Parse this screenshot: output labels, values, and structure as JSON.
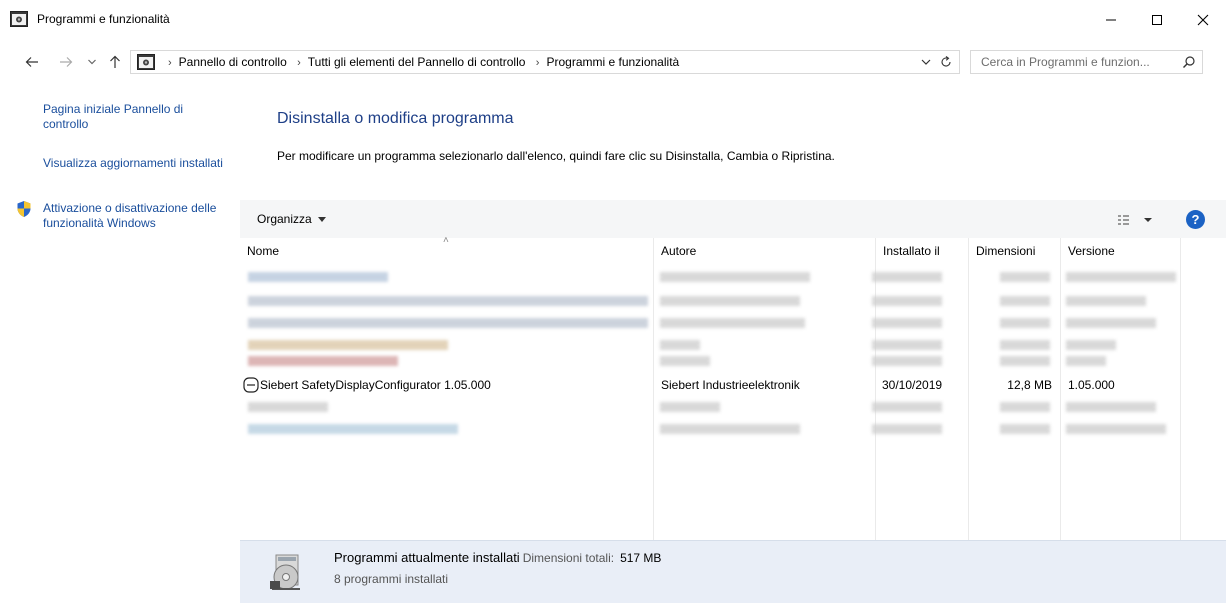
{
  "window": {
    "title": "Programmi e funzionalità",
    "controls": {
      "minimize": "minimize-icon",
      "maximize": "maximize-icon",
      "close": "close-icon"
    }
  },
  "nav": {
    "breadcrumbs": [
      "Pannello di controllo",
      "Tutti gli elementi del Pannello di controllo",
      "Programmi e funzionalità"
    ],
    "search_placeholder": "Cerca in Programmi e funzion..."
  },
  "sidebar": {
    "links": [
      "Pagina iniziale Pannello di controllo",
      "Visualizza aggiornamenti installati",
      "Attivazione o disattivazione delle funzionalità Windows"
    ]
  },
  "main": {
    "heading": "Disinstalla o modifica programma",
    "instructions": "Per modificare un programma selezionarlo dall'elenco, quindi fare clic su Disinstalla, Cambia o Ripristina."
  },
  "toolbar": {
    "organize_label": "Organizza",
    "help_label": "?"
  },
  "table": {
    "columns": [
      "Nome",
      "Autore",
      "Installato il",
      "Dimensioni",
      "Versione"
    ],
    "visible_row": {
      "name": "Siebert SafetyDisplayConfigurator 1.05.000",
      "publisher": "Siebert Industrieelektronik",
      "installed_on": "30/10/2019",
      "size": "12,8 MB",
      "version": "1.05.000"
    }
  },
  "details": {
    "title": "Programmi attualmente installati",
    "total_label": "Dimensioni totali:",
    "total_value": "517 MB",
    "count": "8 programmi installati"
  },
  "colors": {
    "link": "#1a4e9c",
    "heading": "#1e3f87",
    "details_bg": "#e9eef7",
    "help": "#1b62c4"
  }
}
